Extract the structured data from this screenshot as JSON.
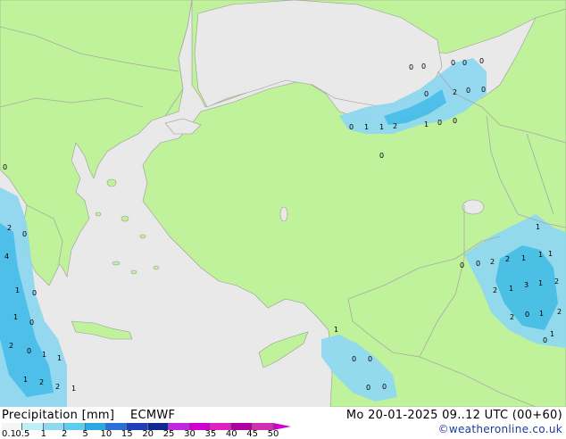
{
  "title": "Precipitation [mm]",
  "model": "ECMWF",
  "valid_time": "Mo 20-01-2025 09..12 UTC (00+60)",
  "credit": "©weatheronline.co.uk",
  "colors": {
    "land": "#bff29a",
    "sea": "#e9e9e9",
    "border": "#a8a8a8",
    "coast": "#9a9a9a",
    "precip_light": "#8fd8f0",
    "precip_mid": "#45bde9"
  },
  "legend": {
    "levels": [
      "0.1",
      "0.5",
      "1",
      "2",
      "5",
      "10",
      "15",
      "20",
      "25",
      "30",
      "35",
      "40",
      "45",
      "50"
    ],
    "colors": [
      "#f5f5f5",
      "#bfeefb",
      "#8fd8f0",
      "#5ecbf0",
      "#2ea8e0",
      "#2c6fd8",
      "#1f3fb8",
      "#102890",
      "#c028e0",
      "#d000d0",
      "#e020c0",
      "#b000a0",
      "#d030b0"
    ]
  },
  "map_labels": [
    "0",
    "0",
    "0",
    "0",
    "0",
    "0",
    "2",
    "0",
    "0",
    "0",
    "1",
    "1",
    "2",
    "1",
    "0",
    "0",
    "0",
    "2",
    "0",
    "4",
    "1",
    "0",
    "1",
    "0",
    "2",
    "0",
    "1",
    "1",
    "2",
    "1",
    "2",
    "1",
    "0",
    "0",
    "2",
    "2",
    "1",
    "1",
    "1",
    "1",
    "2",
    "1",
    "3",
    "1",
    "2",
    "2",
    "0",
    "1",
    "2",
    "1",
    "0",
    "1",
    "0",
    "0",
    "0",
    "0",
    "0"
  ]
}
